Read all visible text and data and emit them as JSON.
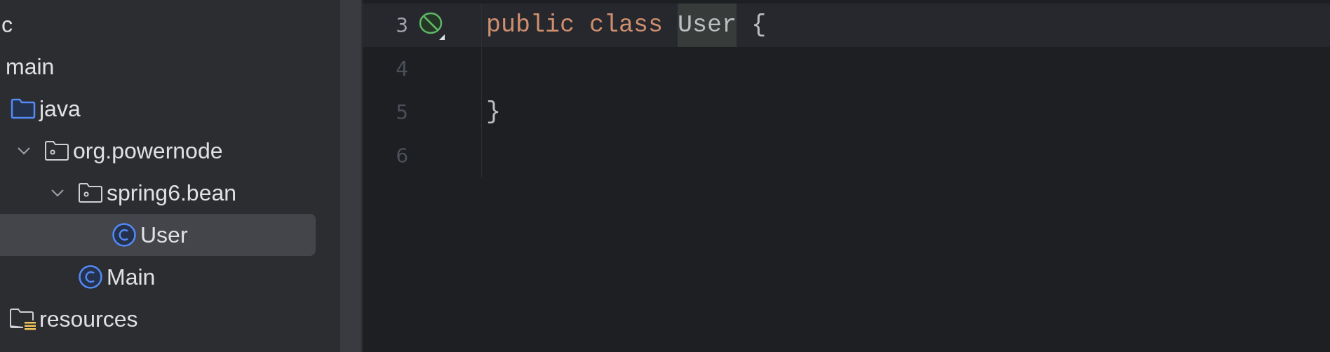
{
  "project_tree": [
    {
      "label": "c",
      "selected": false,
      "children": [
        {
          "label": "main",
          "selected": false,
          "children": [
            {
              "label": "java",
              "kind": "source-folder",
              "selected": false,
              "children": [
                {
                  "label": "org.powernode",
                  "kind": "package",
                  "selected": false,
                  "expanded": true,
                  "children": [
                    {
                      "label": "spring6.bean",
                      "kind": "package",
                      "selected": false,
                      "expanded": true,
                      "children": [
                        {
                          "label": "User",
                          "kind": "class",
                          "selected": true
                        }
                      ]
                    },
                    {
                      "label": "Main",
                      "kind": "class",
                      "selected": false
                    }
                  ]
                }
              ]
            },
            {
              "label": "resources",
              "kind": "resource-folder",
              "selected": false
            }
          ]
        }
      ]
    }
  ],
  "editor": {
    "lines": [
      {
        "number": "3",
        "current": true,
        "marker": true,
        "tokens": [
          {
            "text": "public",
            "kind": "keyword"
          },
          {
            "text": "class",
            "kind": "keyword"
          },
          {
            "text": "User",
            "kind": "identifier",
            "highlighted": true
          },
          {
            "text": "{",
            "kind": "plain"
          }
        ]
      },
      {
        "number": "4",
        "current": false,
        "marker": false
      },
      {
        "number": "5",
        "current": false,
        "marker": false,
        "tokens": [
          {
            "text": "}",
            "kind": "plain"
          }
        ]
      },
      {
        "number": "6",
        "current": false,
        "marker": false
      }
    ]
  }
}
